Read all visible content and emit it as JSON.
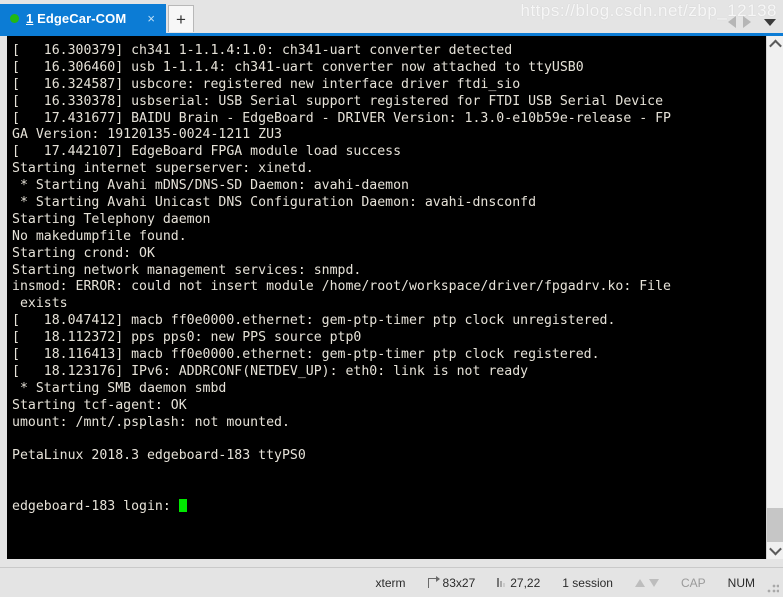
{
  "window": {
    "tab": {
      "accelerator": "1",
      "title": "EdgeCar-COM",
      "status_dot_color": "#22b814",
      "close_label": "×",
      "active_color": "#0c7cd5"
    },
    "new_tab_label": "+",
    "nav": {
      "prev_label": "◀",
      "next_label": "▶",
      "menu_label": "▼"
    }
  },
  "terminal": {
    "background": "#000000",
    "foreground": "#e6e2d8",
    "cursor_color": "#00e800",
    "lines": [
      "[   16.300379] ch341 1-1.1.4:1.0: ch341-uart converter detected",
      "[   16.306460] usb 1-1.1.4: ch341-uart converter now attached to ttyUSB0",
      "[   16.324587] usbcore: registered new interface driver ftdi_sio",
      "[   16.330378] usbserial: USB Serial support registered for FTDI USB Serial Device",
      "[   17.431677] BAIDU Brain - EdgeBoard - DRIVER Version: 1.3.0-e10b59e-release - FP",
      "GA Version: 19120135-0024-1211 ZU3",
      "[   17.442107] EdgeBoard FPGA module load success",
      "Starting internet superserver: xinetd.",
      " * Starting Avahi mDNS/DNS-SD Daemon: avahi-daemon",
      " * Starting Avahi Unicast DNS Configuration Daemon: avahi-dnsconfd",
      "Starting Telephony daemon",
      "No makedumpfile found.",
      "Starting crond: OK",
      "Starting network management services: snmpd.",
      "insmod: ERROR: could not insert module /home/root/workspace/driver/fpgadrv.ko: File",
      " exists",
      "[   18.047412] macb ff0e0000.ethernet: gem-ptp-timer ptp clock unregistered.",
      "[   18.112372] pps pps0: new PPS source ptp0",
      "[   18.116413] macb ff0e0000.ethernet: gem-ptp-timer ptp clock registered.",
      "[   18.123176] IPv6: ADDRCONF(NETDEV_UP): eth0: link is not ready",
      " * Starting SMB daemon smbd",
      "Starting tcf-agent: OK",
      "umount: /mnt/.psplash: not mounted.",
      "",
      "PetaLinux 2018.3 edgeboard-183 ttyPS0",
      "",
      ""
    ],
    "prompt": "edgeboard-183 login: "
  },
  "statusbar": {
    "terminal_type": "xterm",
    "size": "83x27",
    "cursor_position": "27,22",
    "sessions": "1 session",
    "caps_lock": "CAP",
    "num_lock": "NUM"
  },
  "watermark": "https://blog.csdn.net/zbp_12138"
}
